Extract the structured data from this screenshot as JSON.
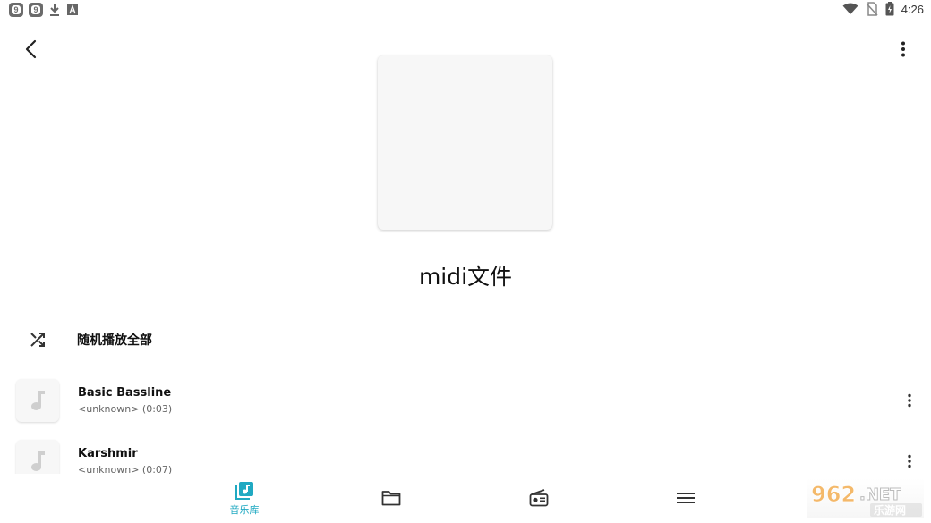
{
  "status_bar": {
    "left_badges": [
      "9",
      "9"
    ],
    "time": "4:26",
    "icons": [
      "download-icon",
      "font-icon",
      "wifi-icon",
      "no-sim-icon",
      "battery-charging-icon"
    ]
  },
  "header": {
    "back_icon": "back-icon",
    "menu_icon": "more-vert-icon"
  },
  "album": {
    "title": "midi文件"
  },
  "shuffle": {
    "label": "随机播放全部",
    "icon": "shuffle-icon"
  },
  "tracks": [
    {
      "title": "Basic Bassline",
      "subtitle": "<unknown> (0:03)",
      "icon": "music-note-icon"
    },
    {
      "title": "Karshmir",
      "subtitle": "<unknown> (0:07)",
      "icon": "music-note-icon"
    }
  ],
  "bottom_nav": {
    "items": [
      {
        "label": "音乐库",
        "icon": "music-library-icon",
        "active": true
      },
      {
        "label": "",
        "icon": "folder-icon",
        "active": false
      },
      {
        "label": "",
        "icon": "radio-icon",
        "active": false
      },
      {
        "label": "",
        "icon": "menu-icon",
        "active": false
      }
    ]
  },
  "watermark": {
    "text": "962.NET",
    "subtext": "乐游网"
  },
  "colors": {
    "accent": "#20a9c2",
    "icon": "#333333",
    "placeholder_note": "#cfcfcf"
  }
}
